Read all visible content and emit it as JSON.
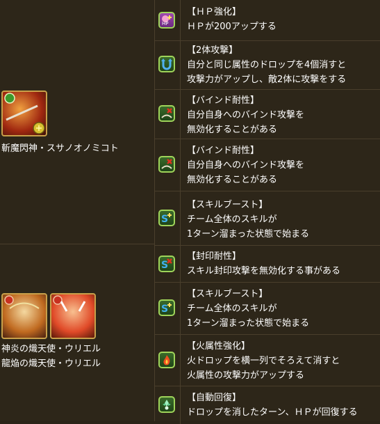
{
  "groups": [
    {
      "character_names": [
        "斬魔閃神・スサノオノミコト"
      ],
      "skills": [
        {
          "icon": "hp-up-icon",
          "title": "【ＨＰ強化】",
          "lines": [
            "ＨＰが200アップする"
          ]
        },
        {
          "icon": "two-way-attack-icon",
          "title": "【2体攻撃】",
          "lines": [
            "自分と同じ属性のドロップを4個消すと",
            "攻撃力がアップし、敵2体に攻撃をする"
          ]
        },
        {
          "icon": "bind-resist-icon",
          "title": "【バインド耐性】",
          "lines": [
            "自分自身へのバインド攻撃を",
            "無効化することがある"
          ]
        },
        {
          "icon": "bind-resist-icon",
          "title": "【バインド耐性】",
          "lines": [
            "自分自身へのバインド攻撃を",
            "無効化することがある"
          ]
        },
        {
          "icon": "skill-boost-icon",
          "title": "【スキルブースト】",
          "lines": [
            "チーム全体のスキルが",
            "1ターン溜まった状態で始まる"
          ]
        }
      ]
    },
    {
      "character_names": [
        "神炎の熾天使・ウリエル",
        "龍焔の熾天使・ウリエル"
      ],
      "skills": [
        {
          "icon": "skill-bind-resist-icon",
          "title": "【封印耐性】",
          "lines": [
            "スキル封印攻撃を無効化する事がある"
          ]
        },
        {
          "icon": "skill-boost-icon",
          "title": "【スキルブースト】",
          "lines": [
            "チーム全体のスキルが",
            "1ターン溜まった状態で始まる"
          ]
        },
        {
          "icon": "fire-row-icon",
          "title": "【火属性強化】",
          "lines": [
            "火ドロップを横一列でそろえて消すと",
            "火属性の攻撃力がアップする"
          ]
        },
        {
          "icon": "auto-recover-icon",
          "title": "【自動回復】",
          "lines": [
            "ドロップを消したターン、ＨＰが回復する"
          ]
        }
      ]
    }
  ]
}
